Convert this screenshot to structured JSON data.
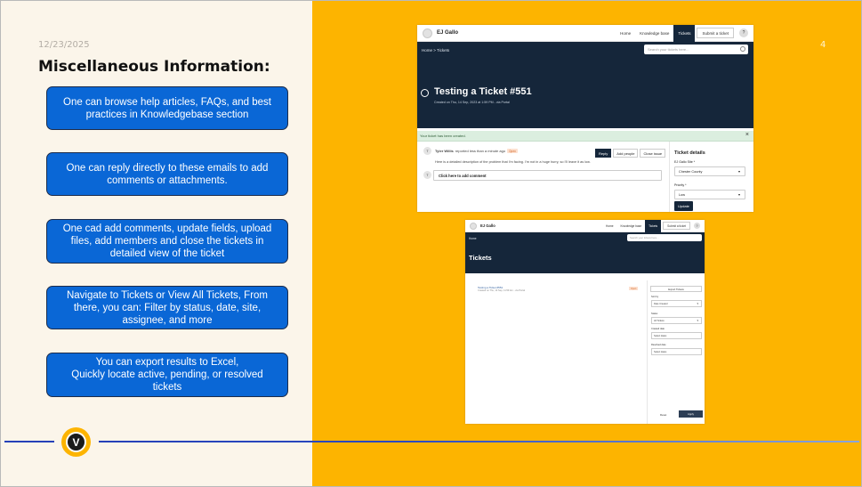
{
  "slide": {
    "date": "12/23/2025",
    "page_number": "4",
    "title": "Miscellaneous Information:",
    "cards": [
      "One can browse help articles, FAQs, and best\npractices in Knowledgebase section",
      "One can reply directly to these emails to add\ncomments or attachments.",
      "One cad add comments, update fields, upload\nfiles, add members and close the tickets in\ndetailed view of the ticket",
      "Navigate to Tickets or View All Tickets, From\nthere, you can: Filter by status, date, site,\nassignee, and more",
      "You can export results to Excel,\nQuickly locate active, pending, or resolved\ntickets"
    ],
    "logo_letter": "V"
  },
  "colors": {
    "left_bg": "#fbf5ea",
    "right_bg": "#fdb400",
    "card_blue": "#0a67d6",
    "navy": "#15263a",
    "line_blue": "#2540b8"
  },
  "screenshot_ticket": {
    "brand": "EJ Gallo",
    "nav": [
      "Home",
      "Knowledge base",
      "Tickets",
      "Submit a ticket"
    ],
    "help": "?",
    "breadcrumb": "Home  >  Tickets",
    "search_placeholder": "Search your tickets here...",
    "heading": "Testing a Ticket #551",
    "subheading": "Created on Thu, 14 Sep, 2023 at 1:59 PM - via Portal",
    "alert": "Your ticket has been created.",
    "alert_close": "×",
    "reporter_initial": "T",
    "reporter": "Tyler Willis",
    "reported_text": "reported less than a minute ago",
    "status": "Open",
    "description": "Here is a detailed description of the problem that I'm facing.  I'm not in a huge hurry, so I'll leave it as low.",
    "comment_initial": "T",
    "comment_placeholder": "Click here to add comment",
    "actions": [
      "Reply",
      "Add people",
      "Close issue"
    ],
    "details_title": "Ticket details",
    "site_label": "EJ Gallo Site *",
    "site_value": "Chester County",
    "priority_label": "Priority *",
    "priority_value": "Low",
    "update_button": "Update"
  },
  "screenshot_tickets": {
    "brand": "EJ Gallo",
    "nav": [
      "Home",
      "Knowledge base",
      "Tickets",
      "Submit a ticket"
    ],
    "help": "?",
    "breadcrumb": "Home",
    "search_placeholder": "Search your tickets here...",
    "heading": "Tickets",
    "ticket_line": "Testing a Ticket #551",
    "ticket_sub": "Created on Thu, 14 Sep, 11:59 Am - via Portal",
    "ticket_status": "Open",
    "filter_header": "Export Tickets",
    "sort_label": "Sort by",
    "sort_value": "Date Created",
    "status_label": "Status",
    "status_value": "All Tickets",
    "created_label": "Created date",
    "created_value": "Select dates",
    "resolved_label": "Resolved date",
    "resolved_value": "Select dates",
    "reset": "Reset",
    "apply": "Apply"
  }
}
